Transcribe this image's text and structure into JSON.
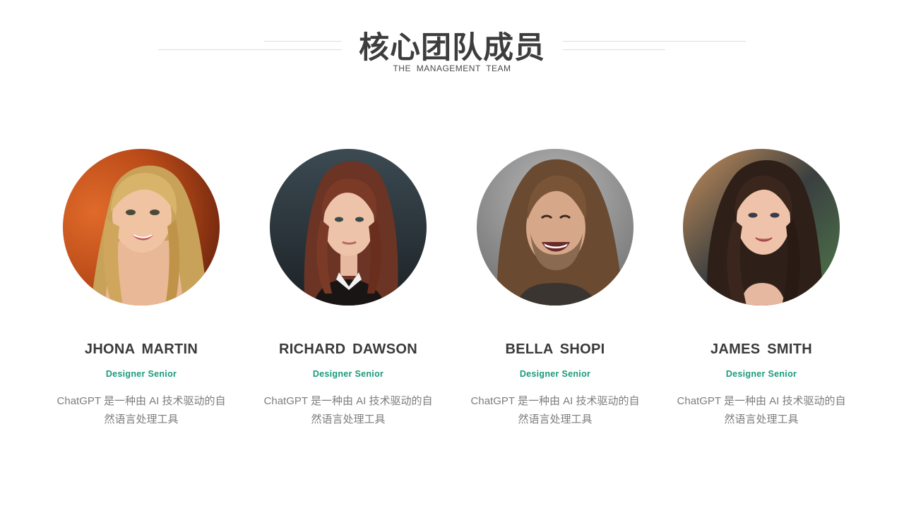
{
  "header": {
    "title": "核心团队成员",
    "subtitle": "THE MANAGEMENT TEAM"
  },
  "colors": {
    "accent": "#1a9a7c",
    "title": "#3d3d3d",
    "body_text": "#7d7d7d",
    "rule": "#dedede"
  },
  "members": [
    {
      "name": "JHONA MARTIN",
      "role": "Designer Senior",
      "description": "ChatGPT 是一种由 AI 技术驱动的自然语言处理工具",
      "photo": "portrait-blonde-woman"
    },
    {
      "name": "RICHARD DAWSON",
      "role": "Designer Senior",
      "description": "ChatGPT 是一种由 AI 技术驱动的自然语言处理工具",
      "photo": "portrait-redhead-woman"
    },
    {
      "name": "BELLA SHOPI",
      "role": "Designer Senior",
      "description": "ChatGPT 是一种由 AI 技术驱动的自然语言处理工具",
      "photo": "portrait-smiling-man"
    },
    {
      "name": "JAMES SMITH",
      "role": "Designer Senior",
      "description": "ChatGPT 是一种由 AI 技术驱动的自然语言处理工具",
      "photo": "portrait-brunette-woman"
    }
  ]
}
